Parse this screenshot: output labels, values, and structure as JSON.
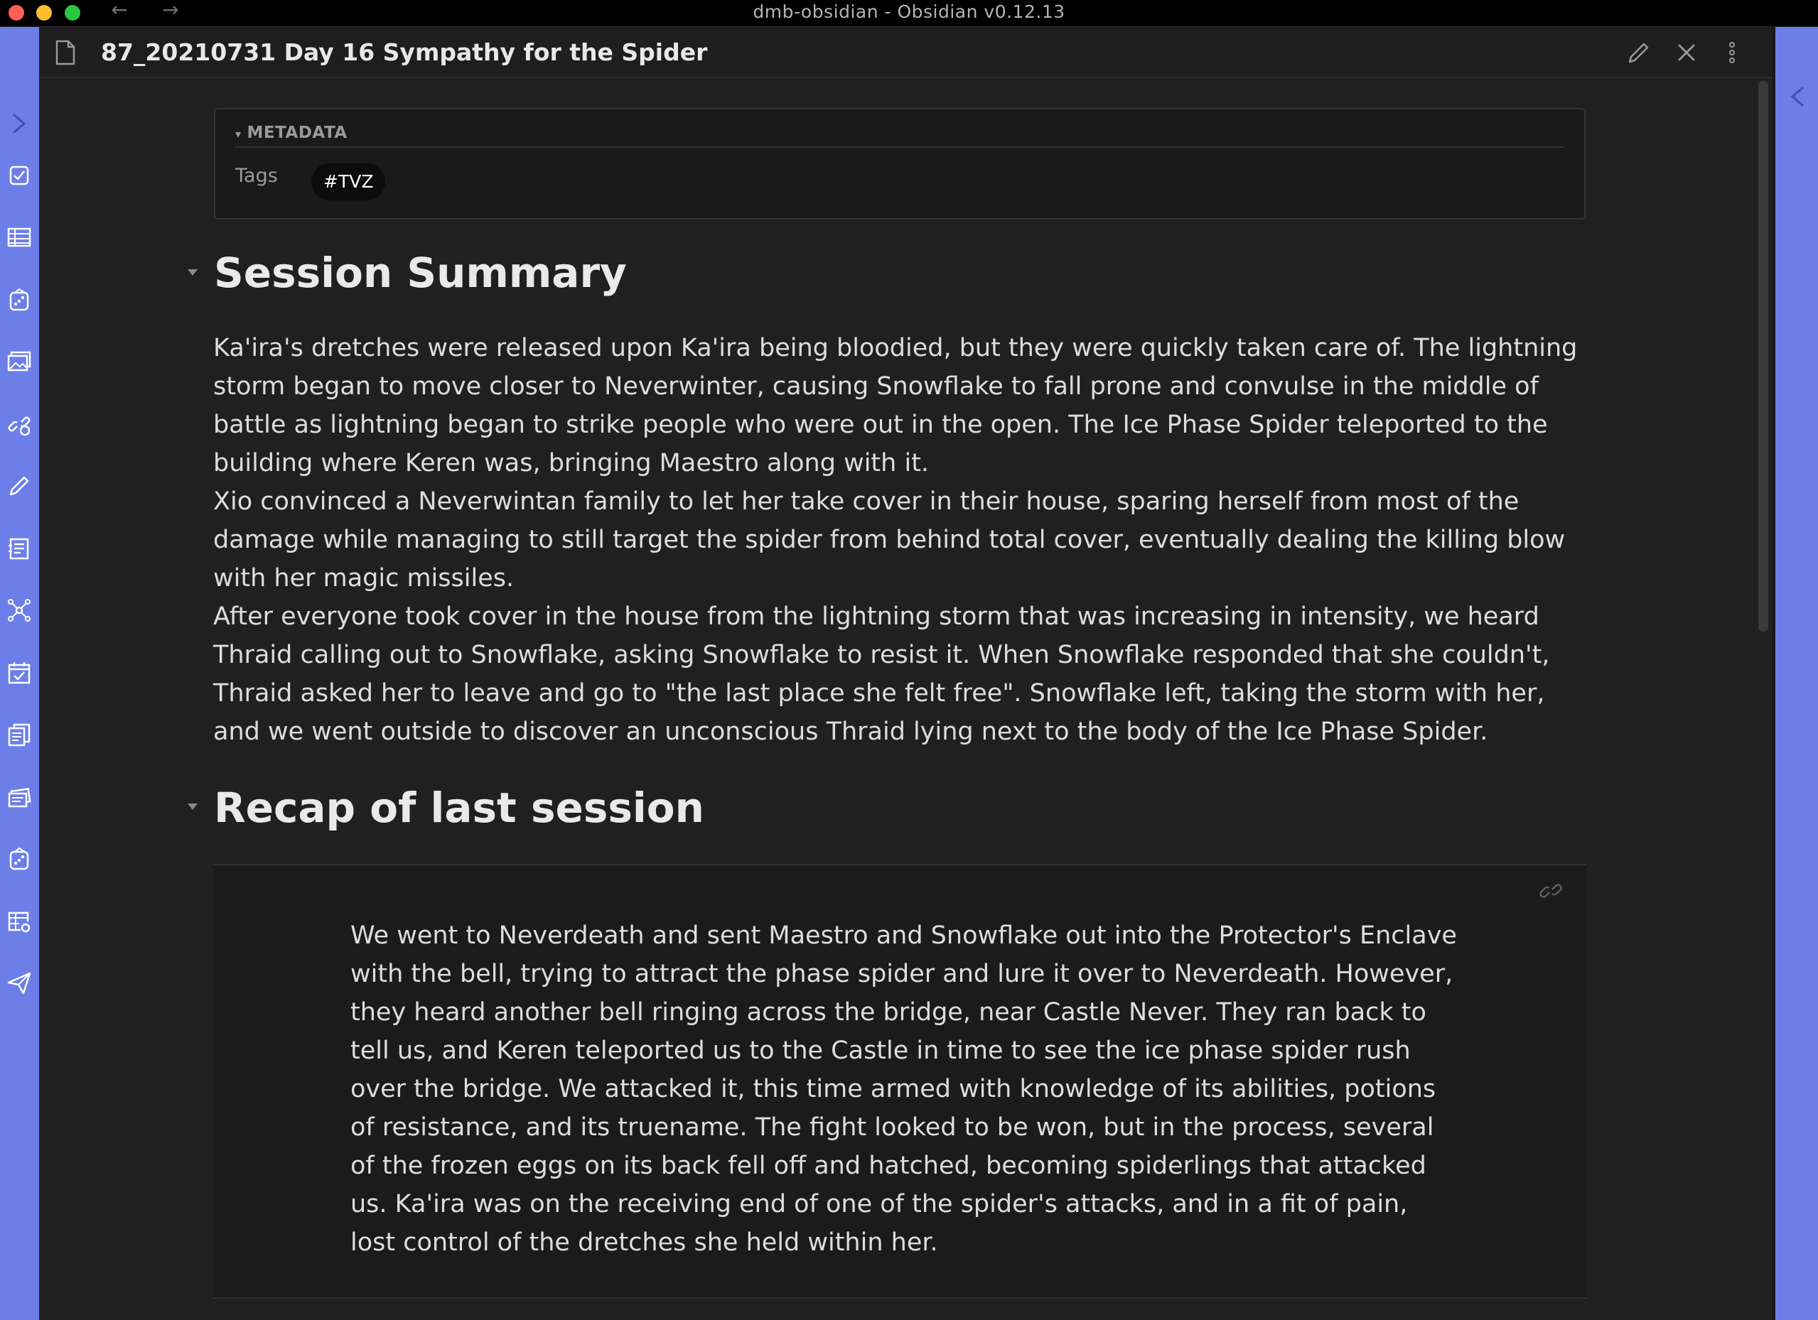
{
  "window": {
    "title": "dmb-obsidian - Obsidian v0.12.13",
    "back_arrow": "←",
    "forward_arrow": "→"
  },
  "ribbon": {
    "icons": [
      "checkbox-icon",
      "table-icon",
      "dice-icon",
      "images-icon",
      "links-icon",
      "pencil-icon",
      "clipboard-list-icon",
      "graph-icon",
      "calendar-check-icon",
      "copy-documents-icon",
      "cards-icon",
      "dice-alt-icon",
      "table-settings-icon",
      "send-icon"
    ]
  },
  "pane": {
    "title": "87_20210731 Day 16 Sympathy for the Spider"
  },
  "metadata": {
    "header": "METADATA",
    "caret": "▾",
    "tags_label": "Tags",
    "tags": [
      "#TVZ"
    ]
  },
  "sections": {
    "summary": {
      "heading": "Session Summary",
      "paragraphs": [
        "Ka'ira's dretches were released upon Ka'ira being bloodied, but they were quickly taken care of. The lightning storm began to move closer to Neverwinter, causing Snowflake to fall prone and convulse in the middle of battle as lightning began to strike people who were out in the open. The Ice Phase Spider teleported to the building where Keren was, bringing Maestro along with it.",
        "Xio convinced a Neverwintan family to let her take cover in their house, sparing herself from most of the damage while managing to still target the spider from behind total cover, eventually dealing the killing blow with her magic missiles.",
        "After everyone took cover in the house from the lightning storm that was increasing in intensity, we heard Thraid calling out to Snowflake, asking Snowflake to resist it. When Snowflake responded that she couldn't, Thraid asked her to leave and go to \"the last place she felt free\". Snowflake left, taking the storm with her, and we went outside to discover an unconscious Thraid lying next to the body of the Ice Phase Spider."
      ]
    },
    "recap": {
      "heading": "Recap of last session",
      "embed_text": "We went to Neverdeath and sent Maestro and Snowflake out into the Protector's Enclave with the bell, trying to attract the phase spider and lure it over to Neverdeath. However, they heard another bell ringing across the bridge, near Castle Never. They ran back to tell us, and Keren teleported us to the Castle in time to see the ice phase spider rush over the bridge. We attacked it, this time armed with knowledge of its abilities, potions of resistance, and its truename. The fight looked to be won, but in the process, several of the frozen eggs on its back fell off and hatched, becoming spiderlings that attacked us. Ka'ira was on the receiving end of one of the spider's attacks, and in a fit of pain, lost control of the dretches she held within her."
    }
  },
  "colors": {
    "accent": "#6c7ee8",
    "background": "#202020",
    "text": "#dcddde"
  }
}
